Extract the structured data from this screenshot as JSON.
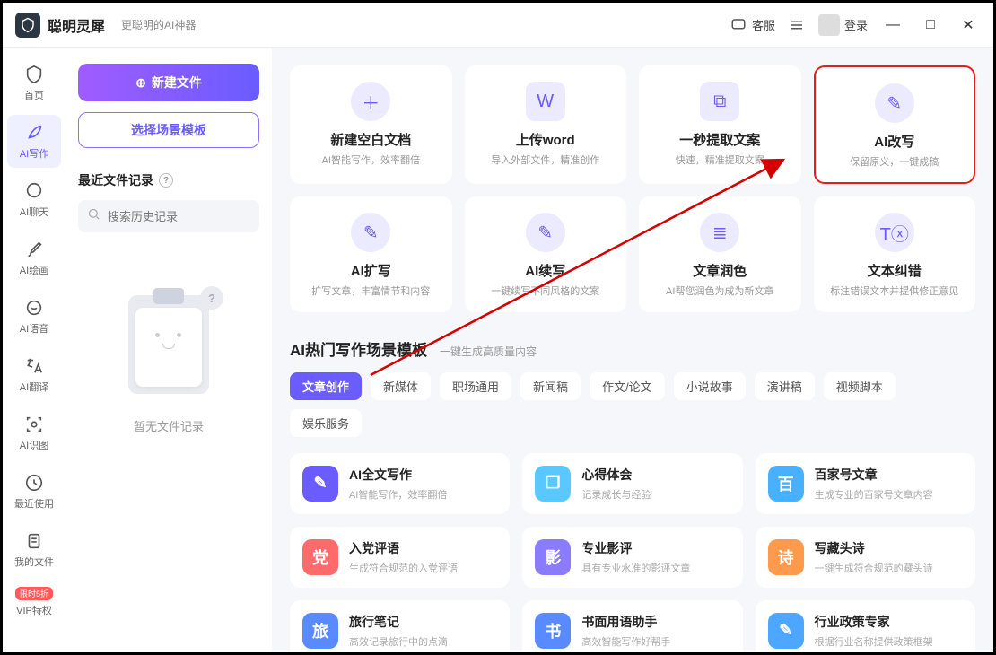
{
  "titlebar": {
    "app_name": "聪明灵犀",
    "tagline": "更聪明的AI神器",
    "service": "客服",
    "login": "登录"
  },
  "sidebar": {
    "items": [
      {
        "label": "首页"
      },
      {
        "label": "AI写作"
      },
      {
        "label": "AI聊天"
      },
      {
        "label": "AI绘画"
      },
      {
        "label": "AI语音"
      },
      {
        "label": "AI翻译"
      },
      {
        "label": "AI识图"
      },
      {
        "label": "最近使用"
      },
      {
        "label": "我的文件"
      },
      {
        "label": "VIP特权",
        "badge": "限时5折"
      }
    ]
  },
  "left": {
    "new_file": "新建文件",
    "choose_template": "选择场景模板",
    "recent_title": "最近文件记录",
    "search_placeholder": "搜索历史记录",
    "empty_text": "暂无文件记录"
  },
  "tiles": [
    {
      "title": "新建空白文档",
      "sub": "AI智能写作，效率翻倍"
    },
    {
      "title": "上传word",
      "sub": "导入外部文件，精准创作"
    },
    {
      "title": "一秒提取文案",
      "sub": "快速，精准提取文案"
    },
    {
      "title": "AI改写",
      "sub": "保留原义，一键成稿"
    },
    {
      "title": "AI扩写",
      "sub": "扩写文章，丰富情节和内容"
    },
    {
      "title": "AI续写",
      "sub": "一键续写不同风格的文案"
    },
    {
      "title": "文章润色",
      "sub": "AI帮您润色为成为新文章"
    },
    {
      "title": "文本纠错",
      "sub": "标注错误文本并提供修正意见"
    }
  ],
  "section": {
    "title": "AI热门写作场景模板",
    "sub": "一键生成高质量内容"
  },
  "tabs": [
    "文章创作",
    "新媒体",
    "职场通用",
    "新闻稿",
    "作文/论文",
    "小说故事",
    "演讲稿",
    "视频脚本",
    "娱乐服务"
  ],
  "templates": [
    {
      "title": "AI全文写作",
      "sub": "AI智能写作，效率翻倍",
      "color": "#6a5cff",
      "glyph": "✎"
    },
    {
      "title": "心得体会",
      "sub": "记录成长与经验",
      "color": "#5ac8ff",
      "glyph": "❐"
    },
    {
      "title": "百家号文章",
      "sub": "生成专业的百家号文章内容",
      "color": "#48b0ff",
      "glyph": "百"
    },
    {
      "title": "入党评语",
      "sub": "生成符合规范的入党评语",
      "color": "#ff6b6b",
      "glyph": "党"
    },
    {
      "title": "专业影评",
      "sub": "具有专业水准的影评文章",
      "color": "#8a7bff",
      "glyph": "影"
    },
    {
      "title": "写藏头诗",
      "sub": "一键生成符合规范的藏头诗",
      "color": "#ff9a4d",
      "glyph": "诗"
    },
    {
      "title": "旅行笔记",
      "sub": "高效记录旅行中的点滴",
      "color": "#5a8aff",
      "glyph": "旅"
    },
    {
      "title": "书面用语助手",
      "sub": "高效智能写作好帮手",
      "color": "#5a8aff",
      "glyph": "书"
    },
    {
      "title": "行业政策专家",
      "sub": "根据行业名称提供政策框架",
      "color": "#4da6ff",
      "glyph": "✎"
    }
  ]
}
